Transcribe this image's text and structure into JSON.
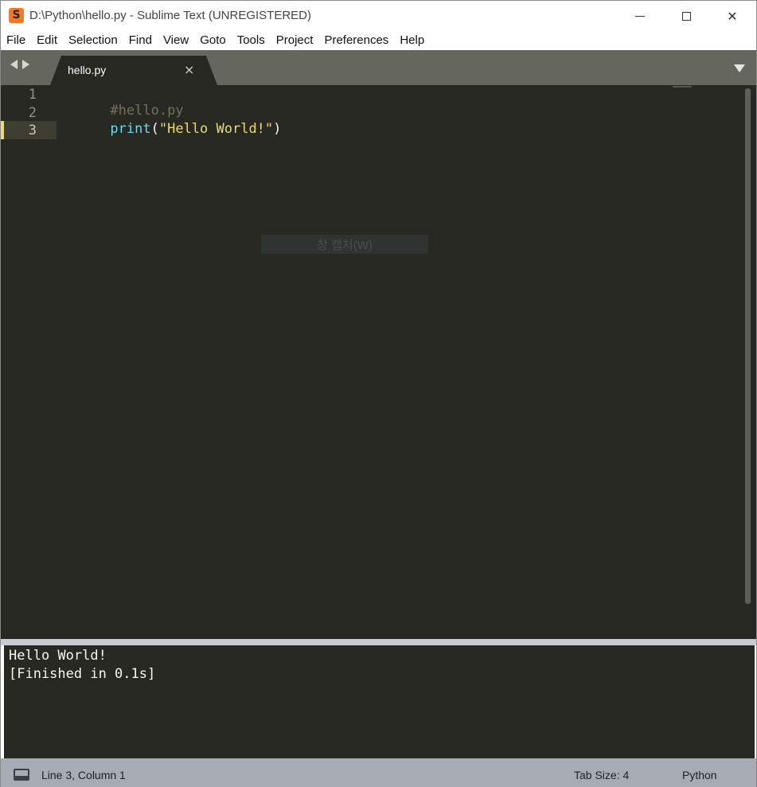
{
  "window": {
    "title": "D:\\Python\\hello.py - Sublime Text (UNREGISTERED)",
    "app_icon_glyph": "S"
  },
  "menu": [
    "File",
    "Edit",
    "Selection",
    "Find",
    "View",
    "Goto",
    "Tools",
    "Project",
    "Preferences",
    "Help"
  ],
  "tabs": [
    {
      "label": "hello.py",
      "close_glyph": "×",
      "active": true
    }
  ],
  "editor": {
    "line_numbers": [
      "1",
      "2",
      "3"
    ],
    "current_line": 3,
    "lines": [
      [
        {
          "type": "comment",
          "text": "#hello.py"
        }
      ],
      [
        {
          "type": "func",
          "text": "print"
        },
        {
          "type": "punct",
          "text": "("
        },
        {
          "type": "string",
          "text": "\"Hello World!\""
        },
        {
          "type": "punct",
          "text": ")"
        }
      ],
      []
    ],
    "ghost_overlay_text": "창 캡처(W)"
  },
  "output": {
    "lines": [
      "Hello World!",
      "[Finished in 0.1s]"
    ]
  },
  "statusbar": {
    "position": "Line 3, Column 1",
    "tab_size": "Tab Size: 4",
    "syntax": "Python"
  },
  "colors": {
    "editor_bg": "#272822",
    "comment": "#75715e",
    "function": "#66d9ef",
    "string": "#e6db74",
    "text": "#f8f8f2",
    "statusbar_bg": "#a6abb4",
    "tabbar_bg": "#65675f",
    "app_icon": "#f57a1f"
  }
}
